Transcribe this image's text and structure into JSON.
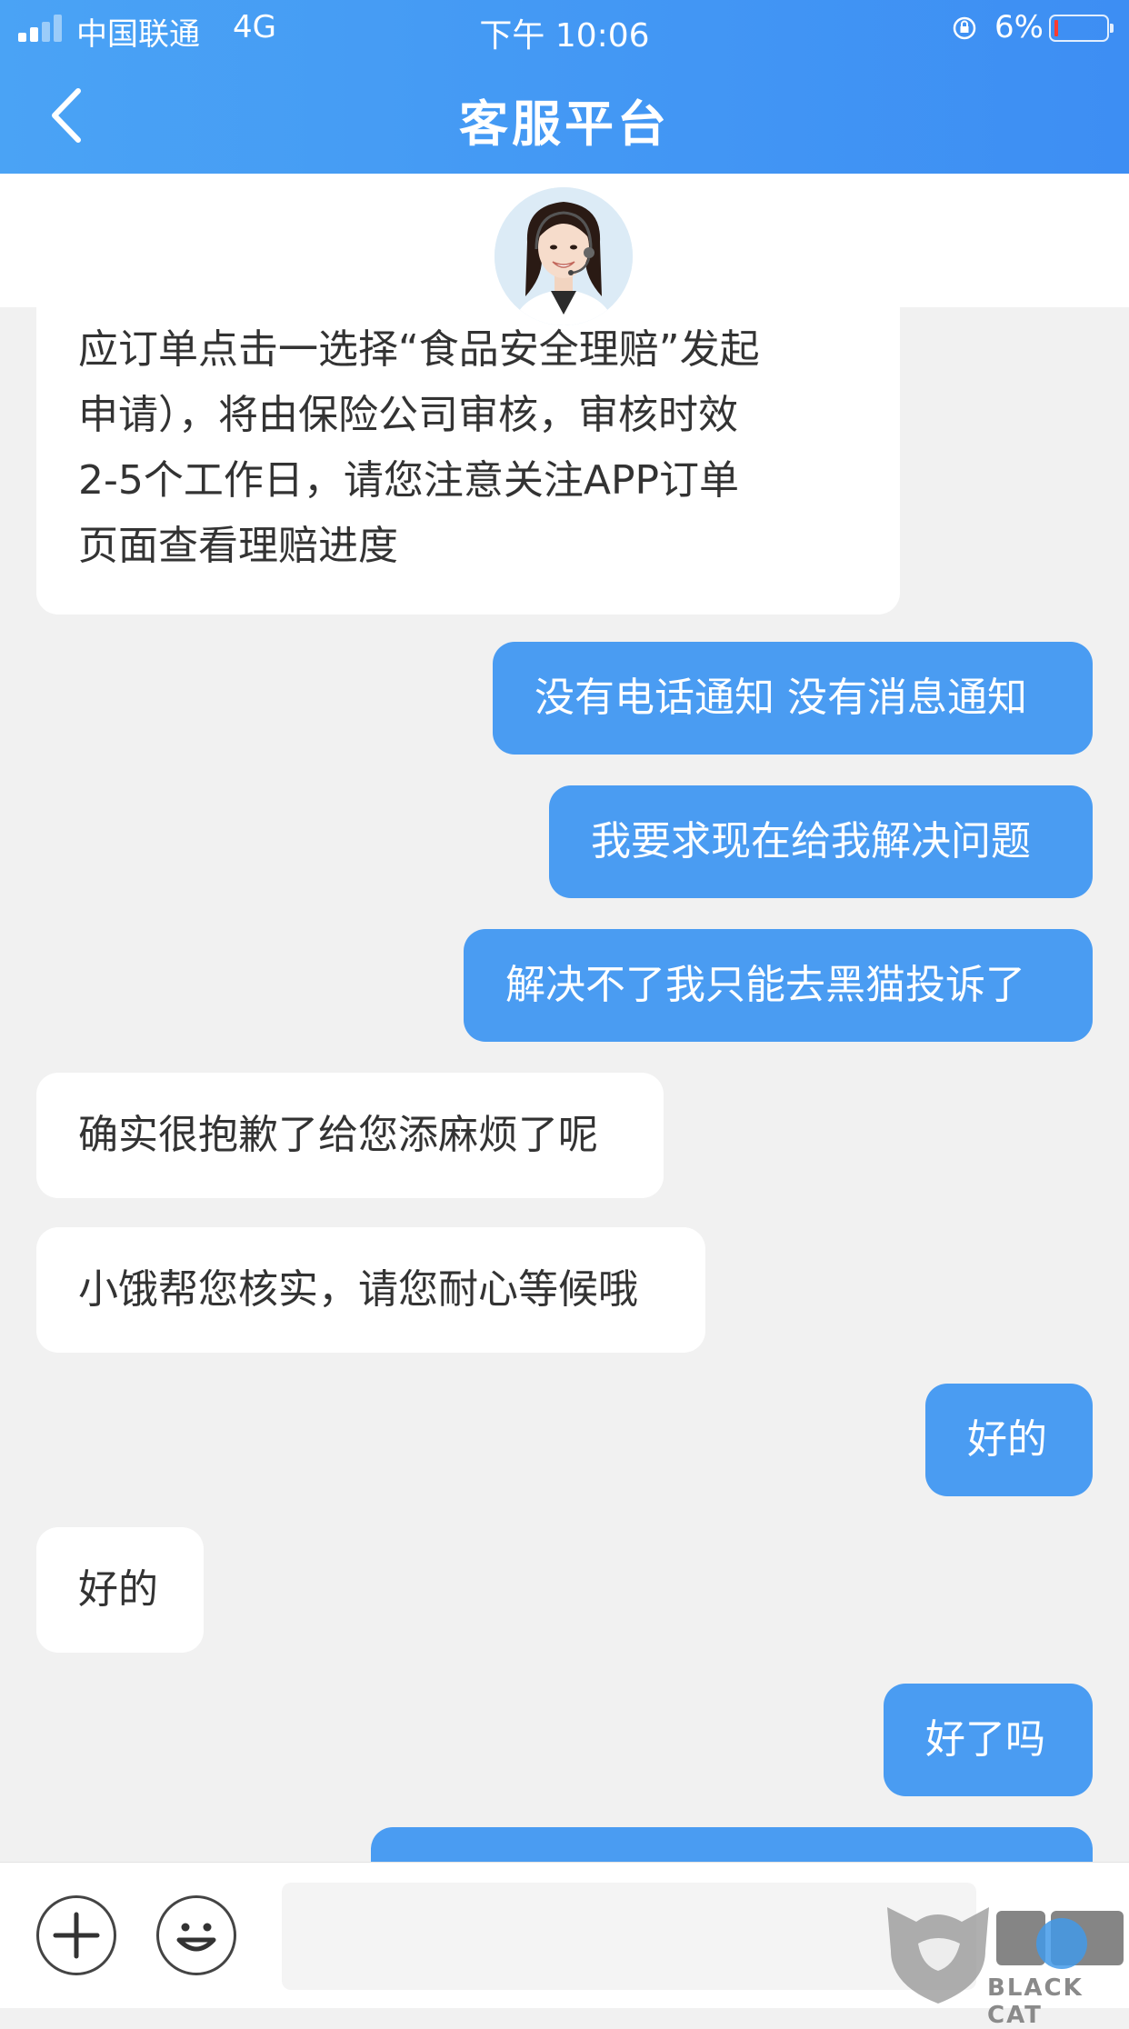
{
  "status_bar": {
    "carrier": "中国联通",
    "network": "4G",
    "time": "下午 10:06",
    "battery": "6%"
  },
  "header": {
    "title": "客服平台"
  },
  "messages": [
    {
      "from": "agent",
      "lines": [
        "应订单点击一选择“食品安全理赔”发起",
        "申请），将由保险公司审核，审核时效",
        "2-5个工作日，请您注意关注APP订单",
        "页面查看理赔进度"
      ]
    },
    {
      "from": "user",
      "text": "没有电话通知 没有消息通知"
    },
    {
      "from": "user",
      "text": "我要求现在给我解决问题"
    },
    {
      "from": "user",
      "text": "解决不了我只能去黑猫投诉了"
    },
    {
      "from": "agent",
      "text": "确实很抱歉了给您添麻烦了呢"
    },
    {
      "from": "agent",
      "text": "小饿帮您核实，请您耐心等候哦"
    },
    {
      "from": "user",
      "text": "好的"
    },
    {
      "from": "agent",
      "text": "好的"
    },
    {
      "from": "user",
      "text": "好了吗"
    }
  ],
  "watermark": {
    "brand": "黑猫",
    "brand_en": "BLACK CAT"
  },
  "icons": {
    "back": "chevron-left-icon",
    "add": "plus-icon",
    "emoji": "smiley-icon",
    "avatar": "customer-service-agent-avatar"
  },
  "colors": {
    "header_blue": "#3d8ef3",
    "user_bubble": "#4a9cf2",
    "agent_bubble": "#ffffff",
    "chat_background": "#f1f1f1"
  }
}
